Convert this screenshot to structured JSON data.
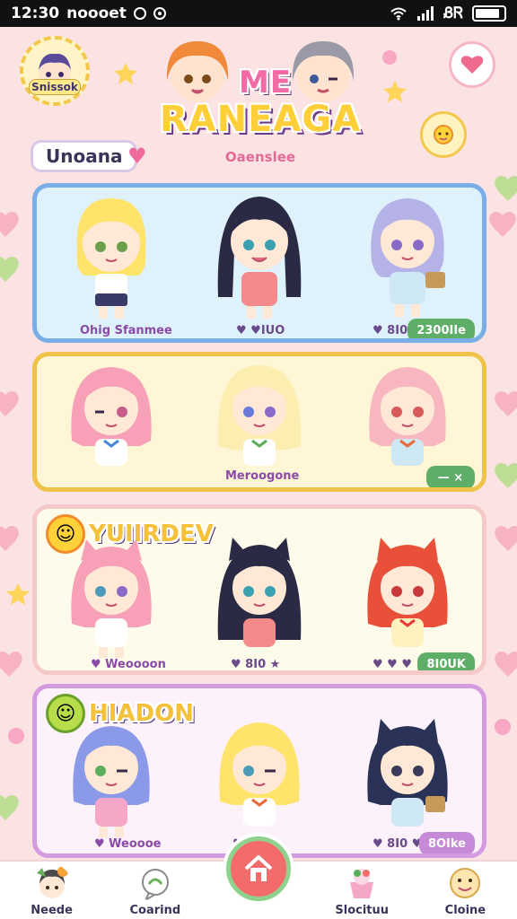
{
  "status_bar": {
    "time": "12:30",
    "carrier": "noooet",
    "right_text": "ᏰᏒ"
  },
  "header": {
    "profile_label": "Snissok",
    "logo_line1": "ME",
    "logo_line2": "RANEAGA",
    "logo_subtitle": "Oaenslee",
    "section_label": "Unoana"
  },
  "cards": [
    {
      "caption": "Ohig Sfanmee",
      "middle": "♥ ♥IUO",
      "right_icons": "♥ 8I0 ♥",
      "tag": "2300IIe"
    },
    {
      "caption": "Meroogone",
      "tag": "— ×"
    },
    {
      "banner": "YUIIRDEV",
      "caption": "♥ Weoooon",
      "middle": "♥ 8I0 ★",
      "right_icons": "♥ ♥ ♥",
      "tag": "8I0UK"
    },
    {
      "banner": "HIADON",
      "caption": "♥ Weoooe",
      "middle": "♥ II0 ★",
      "right_icons": "♥ 8I0 ♥",
      "tag": "8OIke"
    }
  ],
  "bottom_nav": {
    "items": [
      {
        "label": "Neede"
      },
      {
        "label": "Coarind"
      },
      {
        "label": ""
      },
      {
        "label": "Slocituu"
      },
      {
        "label": "Cloine"
      }
    ]
  },
  "colors": {
    "background": "#fbe3e3",
    "card1_border": "#7aaee6",
    "card2_border": "#efc34a",
    "card4_border": "#d59be0",
    "tag_green": "#5fae67",
    "home_button": "#f36b6b"
  }
}
